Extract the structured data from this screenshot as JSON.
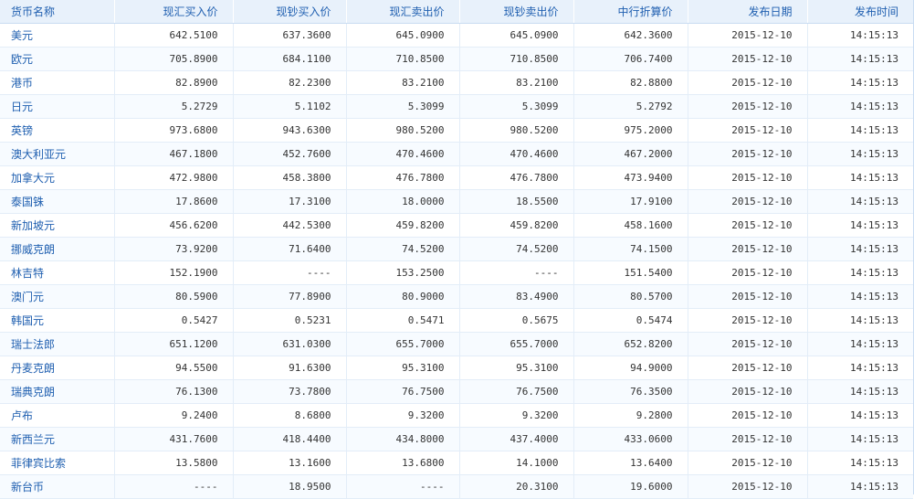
{
  "table": {
    "headers": [
      "货币名称",
      "现汇买入价",
      "现钞买入价",
      "现汇卖出价",
      "现钞卖出价",
      "中行折算价",
      "发布日期",
      "发布时间"
    ],
    "rows": [
      [
        "美元",
        "642.5100",
        "637.3600",
        "645.0900",
        "645.0900",
        "642.3600",
        "2015-12-10",
        "14:15:13"
      ],
      [
        "欧元",
        "705.8900",
        "684.1100",
        "710.8500",
        "710.8500",
        "706.7400",
        "2015-12-10",
        "14:15:13"
      ],
      [
        "港币",
        "82.8900",
        "82.2300",
        "83.2100",
        "83.2100",
        "82.8800",
        "2015-12-10",
        "14:15:13"
      ],
      [
        "日元",
        "5.2729",
        "5.1102",
        "5.3099",
        "5.3099",
        "5.2792",
        "2015-12-10",
        "14:15:13"
      ],
      [
        "英镑",
        "973.6800",
        "943.6300",
        "980.5200",
        "980.5200",
        "975.2000",
        "2015-12-10",
        "14:15:13"
      ],
      [
        "澳大利亚元",
        "467.1800",
        "452.7600",
        "470.4600",
        "470.4600",
        "467.2000",
        "2015-12-10",
        "14:15:13"
      ],
      [
        "加拿大元",
        "472.9800",
        "458.3800",
        "476.7800",
        "476.7800",
        "473.9400",
        "2015-12-10",
        "14:15:13"
      ],
      [
        "泰国铢",
        "17.8600",
        "17.3100",
        "18.0000",
        "18.5500",
        "17.9100",
        "2015-12-10",
        "14:15:13"
      ],
      [
        "新加坡元",
        "456.6200",
        "442.5300",
        "459.8200",
        "459.8200",
        "458.1600",
        "2015-12-10",
        "14:15:13"
      ],
      [
        "挪威克朗",
        "73.9200",
        "71.6400",
        "74.5200",
        "74.5200",
        "74.1500",
        "2015-12-10",
        "14:15:13"
      ],
      [
        "林吉特",
        "152.1900",
        "----",
        "153.2500",
        "----",
        "151.5400",
        "2015-12-10",
        "14:15:13"
      ],
      [
        "澳门元",
        "80.5900",
        "77.8900",
        "80.9000",
        "83.4900",
        "80.5700",
        "2015-12-10",
        "14:15:13"
      ],
      [
        "韩国元",
        "0.5427",
        "0.5231",
        "0.5471",
        "0.5675",
        "0.5474",
        "2015-12-10",
        "14:15:13"
      ],
      [
        "瑞士法郎",
        "651.1200",
        "631.0300",
        "655.7000",
        "655.7000",
        "652.8200",
        "2015-12-10",
        "14:15:13"
      ],
      [
        "丹麦克朗",
        "94.5500",
        "91.6300",
        "95.3100",
        "95.3100",
        "94.9000",
        "2015-12-10",
        "14:15:13"
      ],
      [
        "瑞典克朗",
        "76.1300",
        "73.7800",
        "76.7500",
        "76.7500",
        "76.3500",
        "2015-12-10",
        "14:15:13"
      ],
      [
        "卢布",
        "9.2400",
        "8.6800",
        "9.3200",
        "9.3200",
        "9.2800",
        "2015-12-10",
        "14:15:13"
      ],
      [
        "新西兰元",
        "431.7600",
        "418.4400",
        "434.8000",
        "437.4000",
        "433.0600",
        "2015-12-10",
        "14:15:13"
      ],
      [
        "菲律宾比索",
        "13.5800",
        "13.1600",
        "13.6800",
        "14.1000",
        "13.6400",
        "2015-12-10",
        "14:15:13"
      ],
      [
        "新台币",
        "----",
        "18.9500",
        "----",
        "20.3100",
        "19.6000",
        "2015-12-10",
        "14:15:13"
      ]
    ]
  },
  "colors": {
    "header_bg": "#e8f1fb",
    "header_text": "#1f5fb0",
    "currency_text": "#1f5fb0",
    "value_text": "#333333",
    "grid_line": "#e3edf8"
  }
}
